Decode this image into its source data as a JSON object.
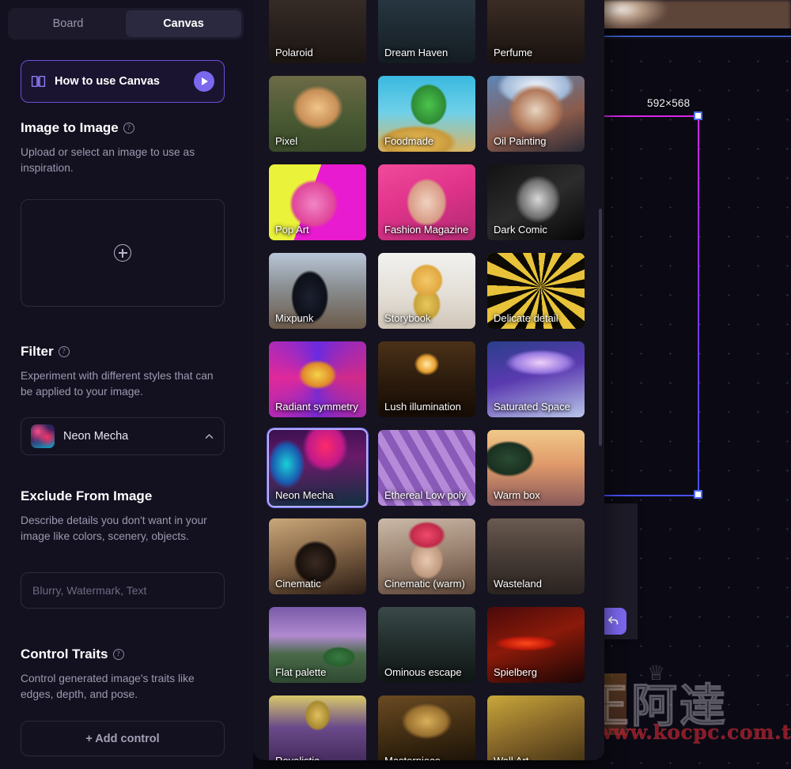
{
  "tabs": {
    "board": "Board",
    "canvas": "Canvas",
    "active": "Canvas"
  },
  "howto": {
    "label": "How to use Canvas",
    "icon": "book-icon",
    "play_icon": "play-icon"
  },
  "image_to_image": {
    "title": "Image to Image",
    "help_glyph": "?",
    "description": "Upload or select an image to use as inspiration.",
    "upload_icon": "plus-circle-icon"
  },
  "filter": {
    "title": "Filter",
    "help_glyph": "?",
    "description": "Experiment with different styles that can be applied to your image.",
    "selected": "Neon Mecha",
    "chevron": "chevron-up-icon"
  },
  "exclude": {
    "title": "Exclude From Image",
    "description": "Describe details you don't want in your image like colors, scenery, objects.",
    "placeholder": "Blurry, Watermark, Text",
    "value": ""
  },
  "control_traits": {
    "title": "Control Traits",
    "help_glyph": "?",
    "description": "Control generated image's traits like edges, depth, and pose.",
    "add_label": "+ Add control"
  },
  "canvas": {
    "selection_size": "592×568",
    "selection_accent_top": "#d726e6",
    "selection_accent_bottom": "#4a4ef8",
    "handle_color": "#ffffff",
    "float_button_icon": "undo-icon",
    "float_button_color": "#7b68ee"
  },
  "watermark": {
    "cjk": "電腦王阿達",
    "url": "http://www.kocpc.com.tw",
    "crown_icon": "crown-icon"
  },
  "filter_grid": {
    "selected": "Neon Mecha",
    "tiles": [
      {
        "label": "Polaroid",
        "partial": true,
        "style": "polaroid"
      },
      {
        "label": "Dream Haven",
        "partial": true,
        "style": "dreamhaven"
      },
      {
        "label": "Perfume",
        "partial": true,
        "style": "perfume"
      },
      {
        "label": "Pixel",
        "partial": false,
        "style": "pixel"
      },
      {
        "label": "Foodmade",
        "partial": false,
        "style": "foodmade"
      },
      {
        "label": "Oil Painting",
        "partial": false,
        "style": "oilpainting"
      },
      {
        "label": "Pop Art",
        "partial": false,
        "style": "popart"
      },
      {
        "label": "Fashion Magazine",
        "partial": false,
        "style": "fashion"
      },
      {
        "label": "Dark Comic",
        "partial": false,
        "style": "darkcomic"
      },
      {
        "label": "Mixpunk",
        "partial": false,
        "style": "mixpunk"
      },
      {
        "label": "Storybook",
        "partial": false,
        "style": "storybook"
      },
      {
        "label": "Delicate detail",
        "partial": false,
        "style": "delicate"
      },
      {
        "label": "Radiant symmetry",
        "partial": false,
        "style": "radiant"
      },
      {
        "label": "Lush illumination",
        "partial": false,
        "style": "lush"
      },
      {
        "label": "Saturated Space",
        "partial": false,
        "style": "saturated"
      },
      {
        "label": "Neon Mecha",
        "partial": false,
        "style": "neonmecha"
      },
      {
        "label": "Ethereal Low poly",
        "partial": false,
        "style": "lowpoly"
      },
      {
        "label": "Warm box",
        "partial": false,
        "style": "warmbox"
      },
      {
        "label": "Cinematic",
        "partial": false,
        "style": "cinematic"
      },
      {
        "label": "Cinematic (warm)",
        "partial": false,
        "style": "cinematicwarm"
      },
      {
        "label": "Wasteland",
        "partial": false,
        "style": "wasteland"
      },
      {
        "label": "Flat palette",
        "partial": false,
        "style": "flatpalette"
      },
      {
        "label": "Ominous escape",
        "partial": false,
        "style": "ominous"
      },
      {
        "label": "Spielberg",
        "partial": false,
        "style": "spielberg"
      },
      {
        "label": "Royalistic",
        "partial": false,
        "style": "royalistic"
      },
      {
        "label": "Masterpiece",
        "partial": false,
        "style": "masterpiece"
      },
      {
        "label": "Wall Art",
        "partial": false,
        "style": "wallart"
      }
    ]
  }
}
